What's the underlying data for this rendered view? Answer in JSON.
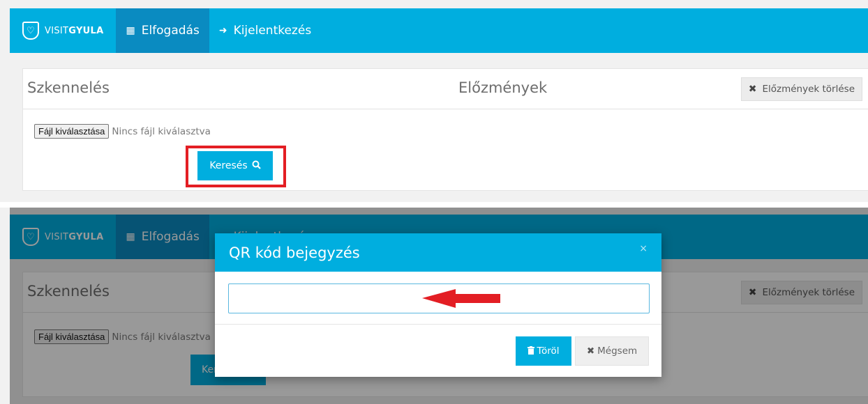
{
  "brand": {
    "prefix": "VISIT",
    "name": "GYULA"
  },
  "nav": {
    "elfogadas": "Elfogadás",
    "kijelentkezes": "Kijelentkezés"
  },
  "card": {
    "scan_title": "Szkennelés",
    "history_title": "Előzmények",
    "clear_history": "Előzmények törlése"
  },
  "file": {
    "button": "Fájl kiválasztása",
    "status": "Nincs fájl kiválasztva"
  },
  "search": {
    "label": "Keresés"
  },
  "modal": {
    "title": "QR kód bejegyzés",
    "close": "×",
    "input_value": "",
    "delete_label": "Töröl",
    "cancel_label": "Mégsem"
  },
  "bottom_search_partial": "Ker",
  "colors": {
    "primary": "#00aedf",
    "nav_active": "#0a8bc1",
    "highlight": "#e31e24"
  },
  "icons": {
    "logo": "heart-shield-icon",
    "elfogadas": "qr-code-icon",
    "kijelentkezes": "sign-out-icon",
    "clear": "close-icon",
    "search": "search-icon",
    "delete": "trash-icon",
    "cancel": "close-icon",
    "annotation": "red-arrow-left"
  }
}
